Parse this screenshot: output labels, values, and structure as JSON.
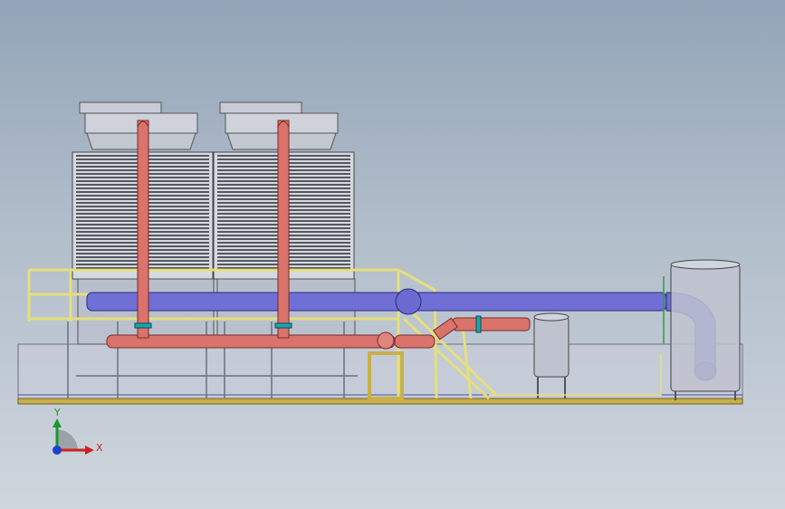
{
  "viewport": {
    "background_top": "#93a5b8",
    "background_bottom": "#cfd6de"
  },
  "model": {
    "colors": {
      "hot_pipe": "#d9736c",
      "cold_pipe": "#6f6fd6",
      "railing": "#e6df7a",
      "tower_body": "#d6d8df",
      "tower_louver": "#2a2d33",
      "tank": "#bfc3cf",
      "skid": "#c8b04a",
      "frame": "#9aa0ae"
    },
    "cooling_towers": 2,
    "tanks": 2
  },
  "triad": {
    "x_label": "X",
    "y_label": "Y",
    "x_color": "#d02020",
    "y_color": "#1a9a2a",
    "z_color": "#2040d0"
  }
}
